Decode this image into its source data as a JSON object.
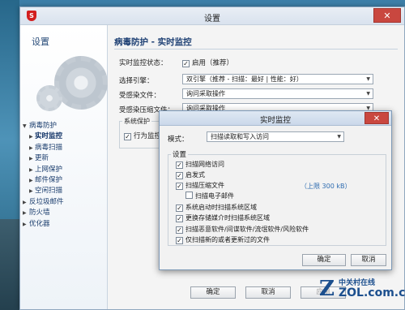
{
  "window": {
    "title": "设置",
    "close": "✕",
    "logo": "S"
  },
  "sidebar": {
    "title": "设置",
    "items": [
      {
        "label": "病毒防护",
        "level": 1,
        "expanded": true
      },
      {
        "label": "实时监控",
        "level": 2,
        "active": true
      },
      {
        "label": "病毒扫描",
        "level": 2
      },
      {
        "label": "更新",
        "level": 2
      },
      {
        "label": "上网保护",
        "level": 2
      },
      {
        "label": "邮件保护",
        "level": 2
      },
      {
        "label": "空闲扫描",
        "level": 2
      },
      {
        "label": "反垃圾邮件",
        "level": 1
      },
      {
        "label": "防火墙",
        "level": 1
      },
      {
        "label": "优化器",
        "level": 1
      }
    ]
  },
  "content": {
    "title": "病毒防护 - 实时监控",
    "status_label": "实时监控状态：",
    "status_value": "启用（推荐）",
    "engine_label": "选择引擎：",
    "engine_value": "双引擎（推荐 - 扫描：最好 | 性能：好）",
    "infected_label": "受感染文件：",
    "infected_value": "询问采取操作",
    "archive_label": "受感染压缩文件：",
    "archive_value": "询问采取操作",
    "sysprotect_legend": "系统保护",
    "behavior_label": "行为监控",
    "ok": "确定",
    "cancel": "取消",
    "apply": "应用"
  },
  "dialog": {
    "title": "实时监控",
    "close": "✕",
    "mode_label": "模式：",
    "mode_value": "扫描读取和写入访问",
    "settings_legend": "设置",
    "options": [
      {
        "label": "扫描网络访问",
        "checked": true
      },
      {
        "label": "启发式",
        "checked": true
      },
      {
        "label": "扫描压缩文件",
        "checked": true
      },
      {
        "label": "扫描电子邮件",
        "checked": false,
        "indent": true
      },
      {
        "label": "系统启动时扫描系统区域",
        "checked": true
      },
      {
        "label": "更换存储媒介时扫描系统区域",
        "checked": true
      },
      {
        "label": "扫描恶意软件/间谍软件/流氓软件/风险软件",
        "checked": true
      },
      {
        "label": "仅扫描新的或者更新过的文件",
        "checked": true
      }
    ],
    "archive_limit": "（上限 300 kB）",
    "ok": "确定",
    "cancel": "取消"
  },
  "watermark": {
    "cn": "中关村在线",
    "en": "ZOL.com.cn",
    "mark": "Z"
  }
}
